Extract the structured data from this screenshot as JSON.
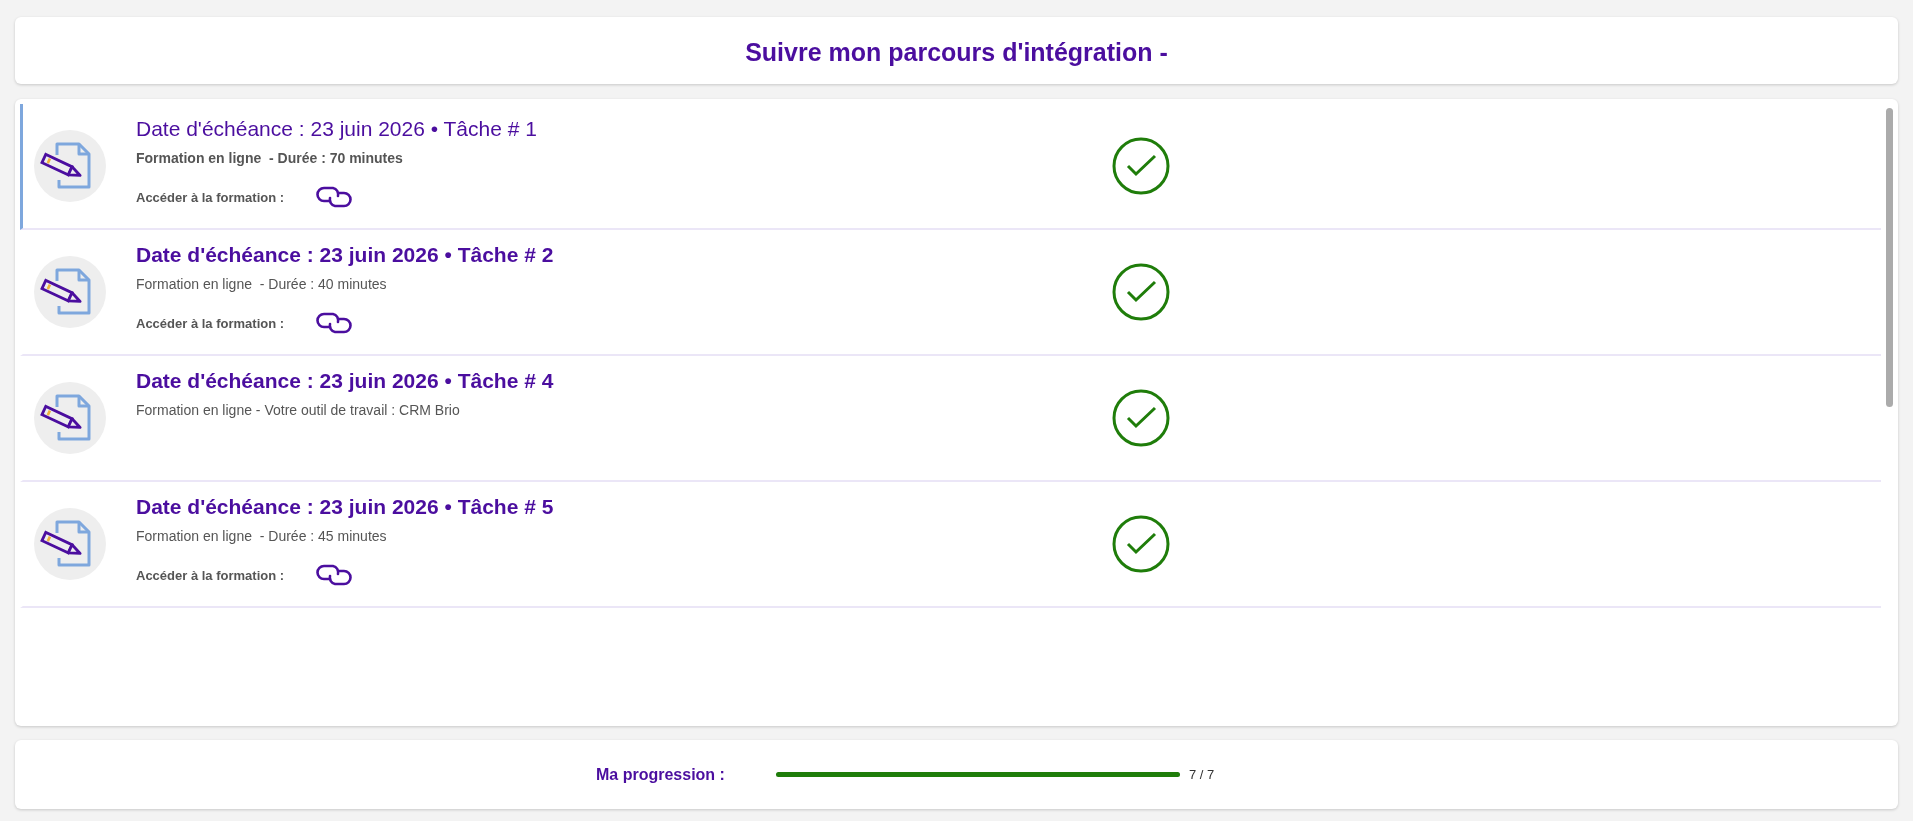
{
  "header": {
    "title": "Suivre mon parcours d'intégration -"
  },
  "tasks": [
    {
      "title": "Date d'échéance : 23 juin 2026 • Tâche # 1",
      "subtitle": "Formation en ligne  - Durée : 70 minutes",
      "link_label": "Accéder à la formation :",
      "selected": true,
      "completed": true
    },
    {
      "title": "Date d'échéance : 23 juin 2026 • Tâche # 2",
      "subtitle": "Formation en ligne  - Durée : 40 minutes",
      "link_label": "Accéder à la formation :",
      "selected": false,
      "completed": true
    },
    {
      "title": "Date d'échéance : 23 juin 2026 • Tâche # 4",
      "subtitle": "Formation en ligne - Votre outil de travail : CRM Brio",
      "selected": false,
      "completed": true
    },
    {
      "title": "Date d'échéance : 23 juin 2026 • Tâche # 5",
      "subtitle": "Formation en ligne  - Durée : 45 minutes",
      "link_label": "Accéder à la formation :",
      "selected": false,
      "completed": true
    }
  ],
  "progress": {
    "label": "Ma progression :",
    "level": 1,
    "reading": "7 / 7"
  }
}
